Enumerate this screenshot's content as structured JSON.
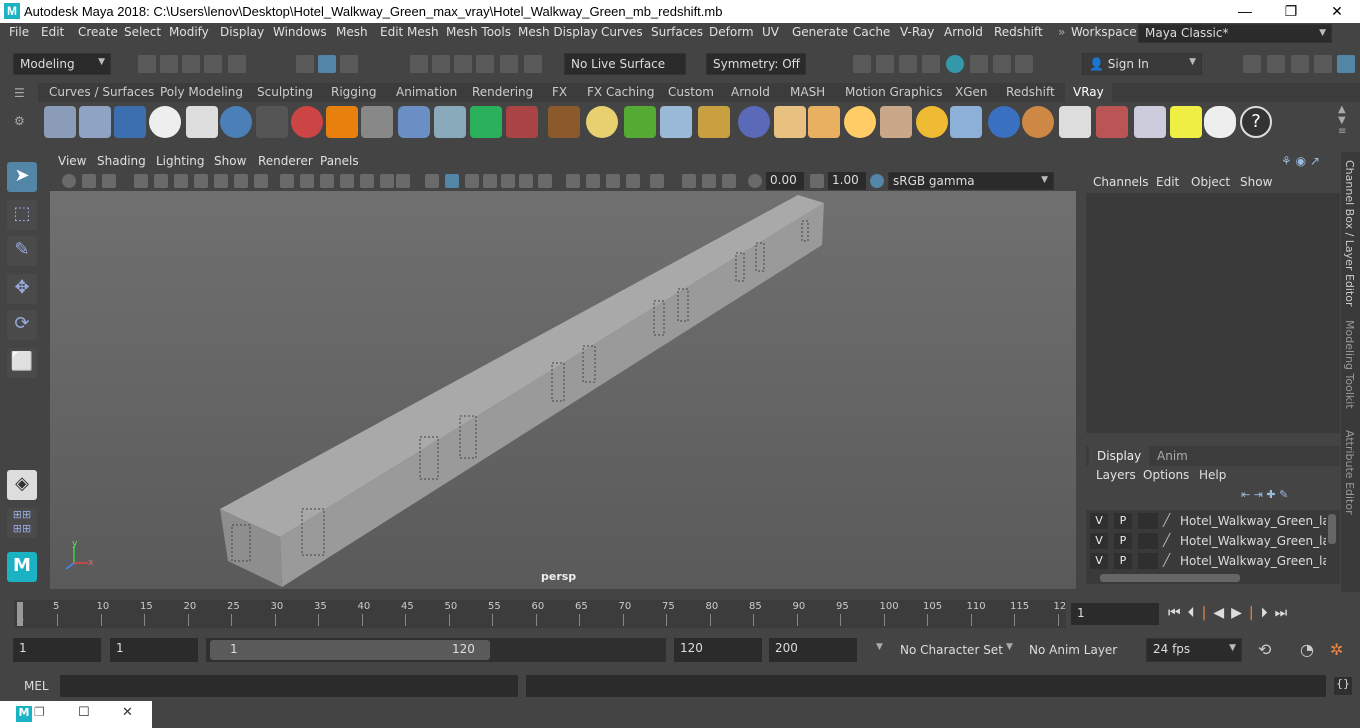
{
  "window": {
    "title": "Autodesk Maya 2018: C:\\Users\\lenov\\Desktop\\Hotel_Walkway_Green_max_vray\\Hotel_Walkway_Green_mb_redshift.mb",
    "logo_letter": "M",
    "minimize": "—",
    "maximize": "❐",
    "close": "✕"
  },
  "menubar": [
    "File",
    "Edit",
    "Create",
    "Select",
    "Modify",
    "Display",
    "Windows",
    "Mesh",
    "Edit Mesh",
    "Mesh Tools",
    "Mesh Display",
    "Curves",
    "Surfaces",
    "Deform",
    "UV",
    "Generate",
    "Cache",
    "V-Ray",
    "Arnold",
    "Redshift"
  ],
  "workspace": {
    "label": "Workspace :",
    "value": "Maya Classic*"
  },
  "statusline": {
    "mode": "Modeling",
    "live_surface": "No Live Surface",
    "symmetry": "Symmetry: Off",
    "sign_in": "Sign In"
  },
  "shelf_tabs": [
    "Curves / Surfaces",
    "Poly Modeling",
    "Sculpting",
    "Rigging",
    "Animation",
    "Rendering",
    "FX",
    "FX Caching",
    "Custom",
    "Arnold",
    "MASH",
    "Motion Graphics",
    "XGen",
    "Redshift",
    "VRay"
  ],
  "shelf_active": "VRay",
  "panel_menu": [
    "View",
    "Shading",
    "Lighting",
    "Show",
    "Renderer",
    "Panels"
  ],
  "panel_toolbar": {
    "exposure": "0.00",
    "gamma": "1.00",
    "color_space": "sRGB gamma"
  },
  "viewport": {
    "camera_label": "persp",
    "axis_y": "y",
    "axis_x": "x"
  },
  "channel_box": {
    "tabs": [
      "Channels",
      "Edit",
      "Object",
      "Show"
    ]
  },
  "layer_editor": {
    "tabs": [
      "Display",
      "Anim"
    ],
    "menus": [
      "Layers",
      "Options",
      "Help"
    ],
    "layers": [
      {
        "v": "V",
        "p": "P",
        "name": "Hotel_Walkway_Green_layer"
      },
      {
        "v": "V",
        "p": "P",
        "name": "Hotel_Walkway_Green_layer"
      },
      {
        "v": "V",
        "p": "P",
        "name": "Hotel_Walkway_Green_layer"
      }
    ]
  },
  "side_tabs": [
    "Channel Box / Layer Editor",
    "Modeling Toolkit",
    "Attribute Editor"
  ],
  "timeline": {
    "ticks": [
      "1",
      "5",
      "10",
      "15",
      "20",
      "25",
      "30",
      "35",
      "40",
      "45",
      "50",
      "55",
      "60",
      "65",
      "70",
      "75",
      "80",
      "85",
      "90",
      "95",
      "100",
      "105",
      "110",
      "115",
      "12"
    ],
    "current_frame": "1"
  },
  "range": {
    "start": "1",
    "playback_start": "1",
    "slider_start": "1",
    "slider_end": "120",
    "playback_end": "120",
    "end": "200",
    "character_set": "No Character Set",
    "anim_layer": "No Anim Layer",
    "fps": "24 fps"
  },
  "cmdline": {
    "label": "MEL"
  },
  "colors": {
    "accent": "#5285a6",
    "bg": "#444444",
    "field": "#2b2b2b"
  }
}
